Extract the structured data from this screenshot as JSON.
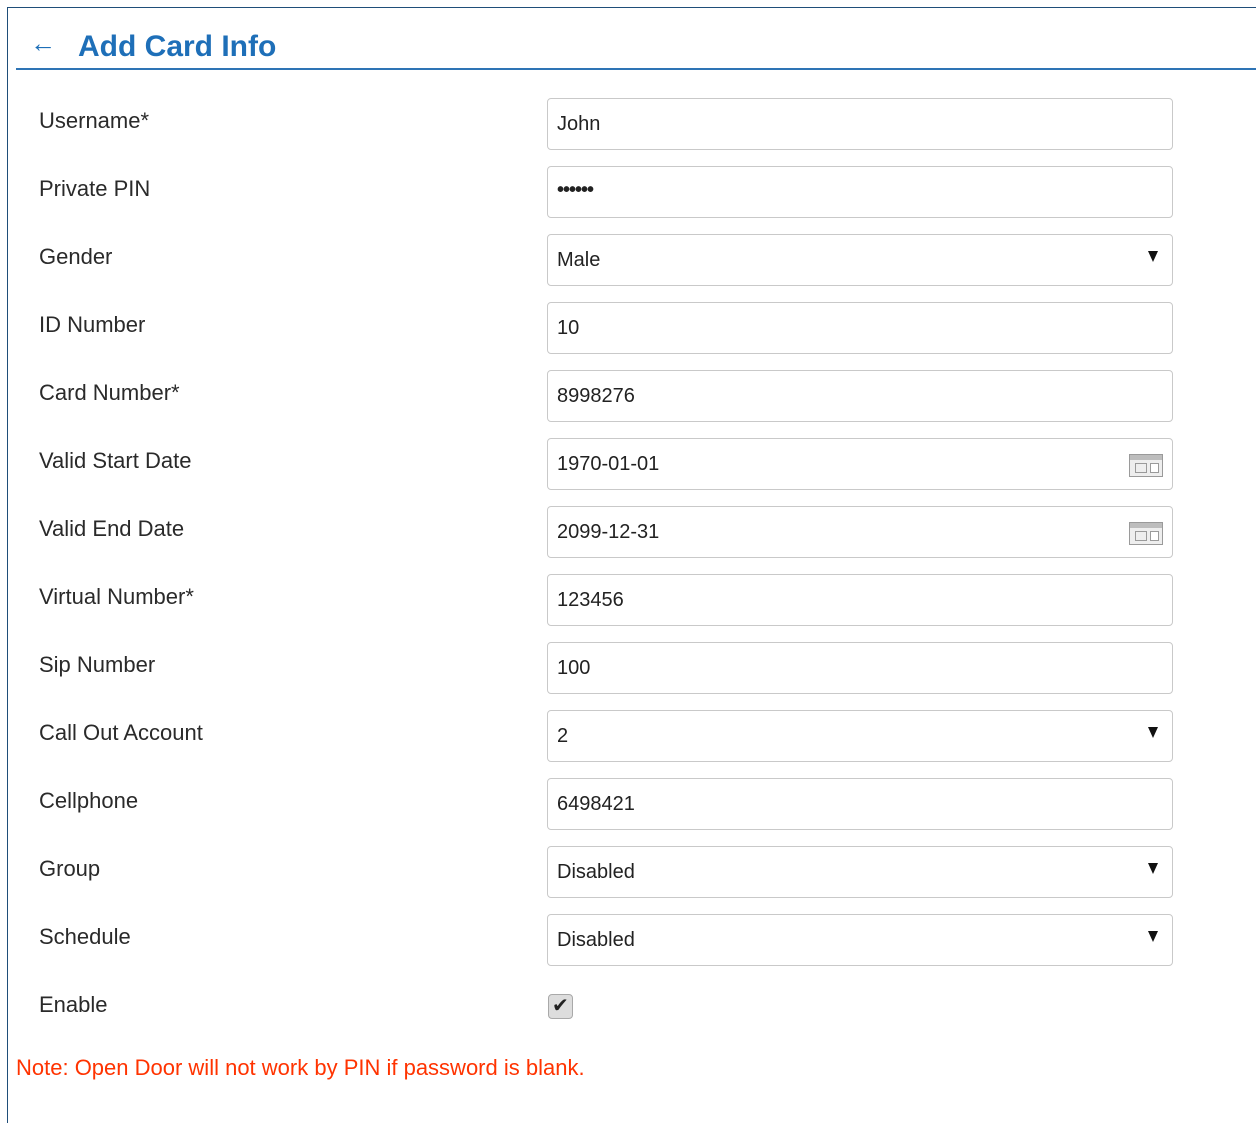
{
  "header": {
    "back_glyph": "←",
    "title": "Add Card Info"
  },
  "form": {
    "username": {
      "label": "Username*",
      "value": "John"
    },
    "private_pin": {
      "label": "Private PIN",
      "value": "••••••"
    },
    "gender": {
      "label": "Gender",
      "value": "Male"
    },
    "id_number": {
      "label": "ID Number",
      "value": "10"
    },
    "card_number": {
      "label": "Card Number*",
      "value": "8998276"
    },
    "valid_start_date": {
      "label": "Valid Start Date",
      "value": "1970-01-01"
    },
    "valid_end_date": {
      "label": "Valid End Date",
      "value": "2099-12-31"
    },
    "virtual_number": {
      "label": "Virtual Number*",
      "value": "123456"
    },
    "sip_number": {
      "label": "Sip Number",
      "value": "100"
    },
    "call_out_account": {
      "label": "Call Out Account",
      "value": "2"
    },
    "cellphone": {
      "label": "Cellphone",
      "value": "6498421"
    },
    "group": {
      "label": "Group",
      "value": "Disabled"
    },
    "schedule": {
      "label": "Schedule",
      "value": "Disabled"
    },
    "enable": {
      "label": "Enable",
      "checked": true,
      "check_glyph": "✔"
    }
  },
  "note": "Note: Open Door will not work by PIN if password is blank.",
  "colors": {
    "accent": "#1e6fb8",
    "note": "#ff3300",
    "border": "#c9c9c9"
  },
  "icons": {
    "back": "arrow-left-icon",
    "dropdown": "caret-down-icon",
    "calendar": "calendar-icon",
    "checkbox": "checkmark-icon"
  }
}
